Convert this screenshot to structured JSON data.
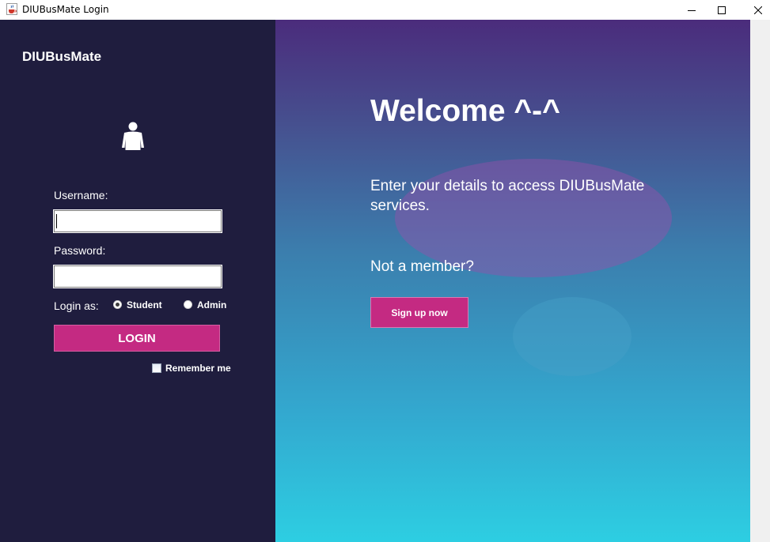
{
  "window": {
    "title": "DIUBusMate Login",
    "app_icon": "java-cup-icon",
    "controls": [
      "minimize-icon",
      "maximize-icon",
      "close-icon"
    ]
  },
  "left_panel": {
    "brand": "DIUBusMate",
    "user_icon": "user-icon",
    "username_label": "Username:",
    "username_value": "",
    "password_label": "Password:",
    "password_value": "",
    "login_as_label": "Login as:",
    "roles": [
      {
        "label": "Student",
        "selected": true
      },
      {
        "label": "Admin",
        "selected": false
      }
    ],
    "login_button": "LOGIN",
    "remember_me": {
      "label": "Remember me",
      "checked": false
    }
  },
  "right_panel": {
    "heading": "Welcome ^-^",
    "subtitle": "Enter your details to access DIUBusMate services.",
    "prompt": "Not a member?",
    "signup_button": "Sign up now"
  },
  "colors": {
    "left_bg": "#1f1d3e",
    "accent": "#c42a82",
    "gradient_top": "#4b2c7c",
    "gradient_bottom": "#2dcee2"
  }
}
